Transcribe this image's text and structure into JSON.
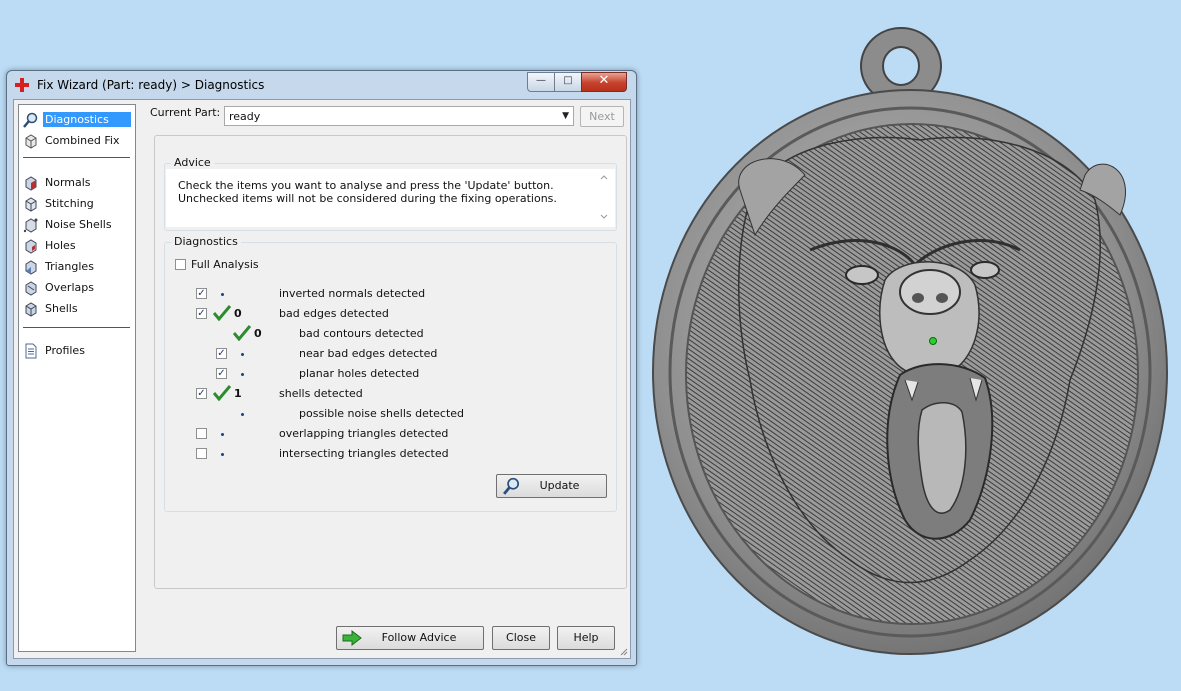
{
  "window": {
    "title": "Fix Wizard (Part: ready) > Diagnostics",
    "controls": {
      "minimize": "—",
      "maximize": "□",
      "close": "✕"
    }
  },
  "nav": {
    "items": [
      {
        "label": "Diagnostics",
        "icon": "magnifier-icon",
        "selected": true
      },
      {
        "label": "Combined Fix",
        "icon": "cube-fix-icon"
      },
      {
        "label": "Normals",
        "icon": "normals-icon"
      },
      {
        "label": "Stitching",
        "icon": "stitching-icon"
      },
      {
        "label": "Noise Shells",
        "icon": "noise-shells-icon"
      },
      {
        "label": "Holes",
        "icon": "holes-icon"
      },
      {
        "label": "Triangles",
        "icon": "triangles-icon"
      },
      {
        "label": "Overlaps",
        "icon": "overlaps-icon"
      },
      {
        "label": "Shells",
        "icon": "shells-icon"
      },
      {
        "label": "Profiles",
        "icon": "document-icon"
      }
    ]
  },
  "part": {
    "label": "Current Part:",
    "value": "ready",
    "next_label": "Next"
  },
  "advice": {
    "title": "Advice",
    "text": "Check the items you want to analyse and press the 'Update' button. Unchecked items will not be considered during the fixing operations."
  },
  "diagnostics": {
    "title": "Diagnostics",
    "full_analysis_label": "Full Analysis",
    "full_analysis_checked": false,
    "rows": [
      {
        "label": "inverted normals detected",
        "checked": true,
        "status": "dot",
        "count": ""
      },
      {
        "label": "bad edges detected",
        "checked": true,
        "status": "ok",
        "count": "0"
      },
      {
        "label": "bad contours detected",
        "checked": null,
        "status": "ok",
        "count": "0"
      },
      {
        "label": "near bad edges detected",
        "checked": true,
        "status": "dot",
        "count": ""
      },
      {
        "label": "planar holes detected",
        "checked": true,
        "status": "dot",
        "count": ""
      },
      {
        "label": "shells detected",
        "checked": true,
        "status": "ok",
        "count": "1"
      },
      {
        "label": "possible noise shells detected",
        "checked": null,
        "status": "dot",
        "count": ""
      },
      {
        "label": "overlapping triangles detected",
        "checked": false,
        "status": "dot",
        "count": ""
      },
      {
        "label": "intersecting triangles detected",
        "checked": false,
        "status": "dot",
        "count": ""
      }
    ],
    "update_label": "Update"
  },
  "footer": {
    "follow_advice_label": "Follow Advice",
    "close_label": "Close",
    "help_label": "Help"
  },
  "colors": {
    "background": "#bcdcf6",
    "selection": "#3399ff",
    "check_green": "#2e8b2e",
    "model_gray": "#8a8a8a"
  }
}
